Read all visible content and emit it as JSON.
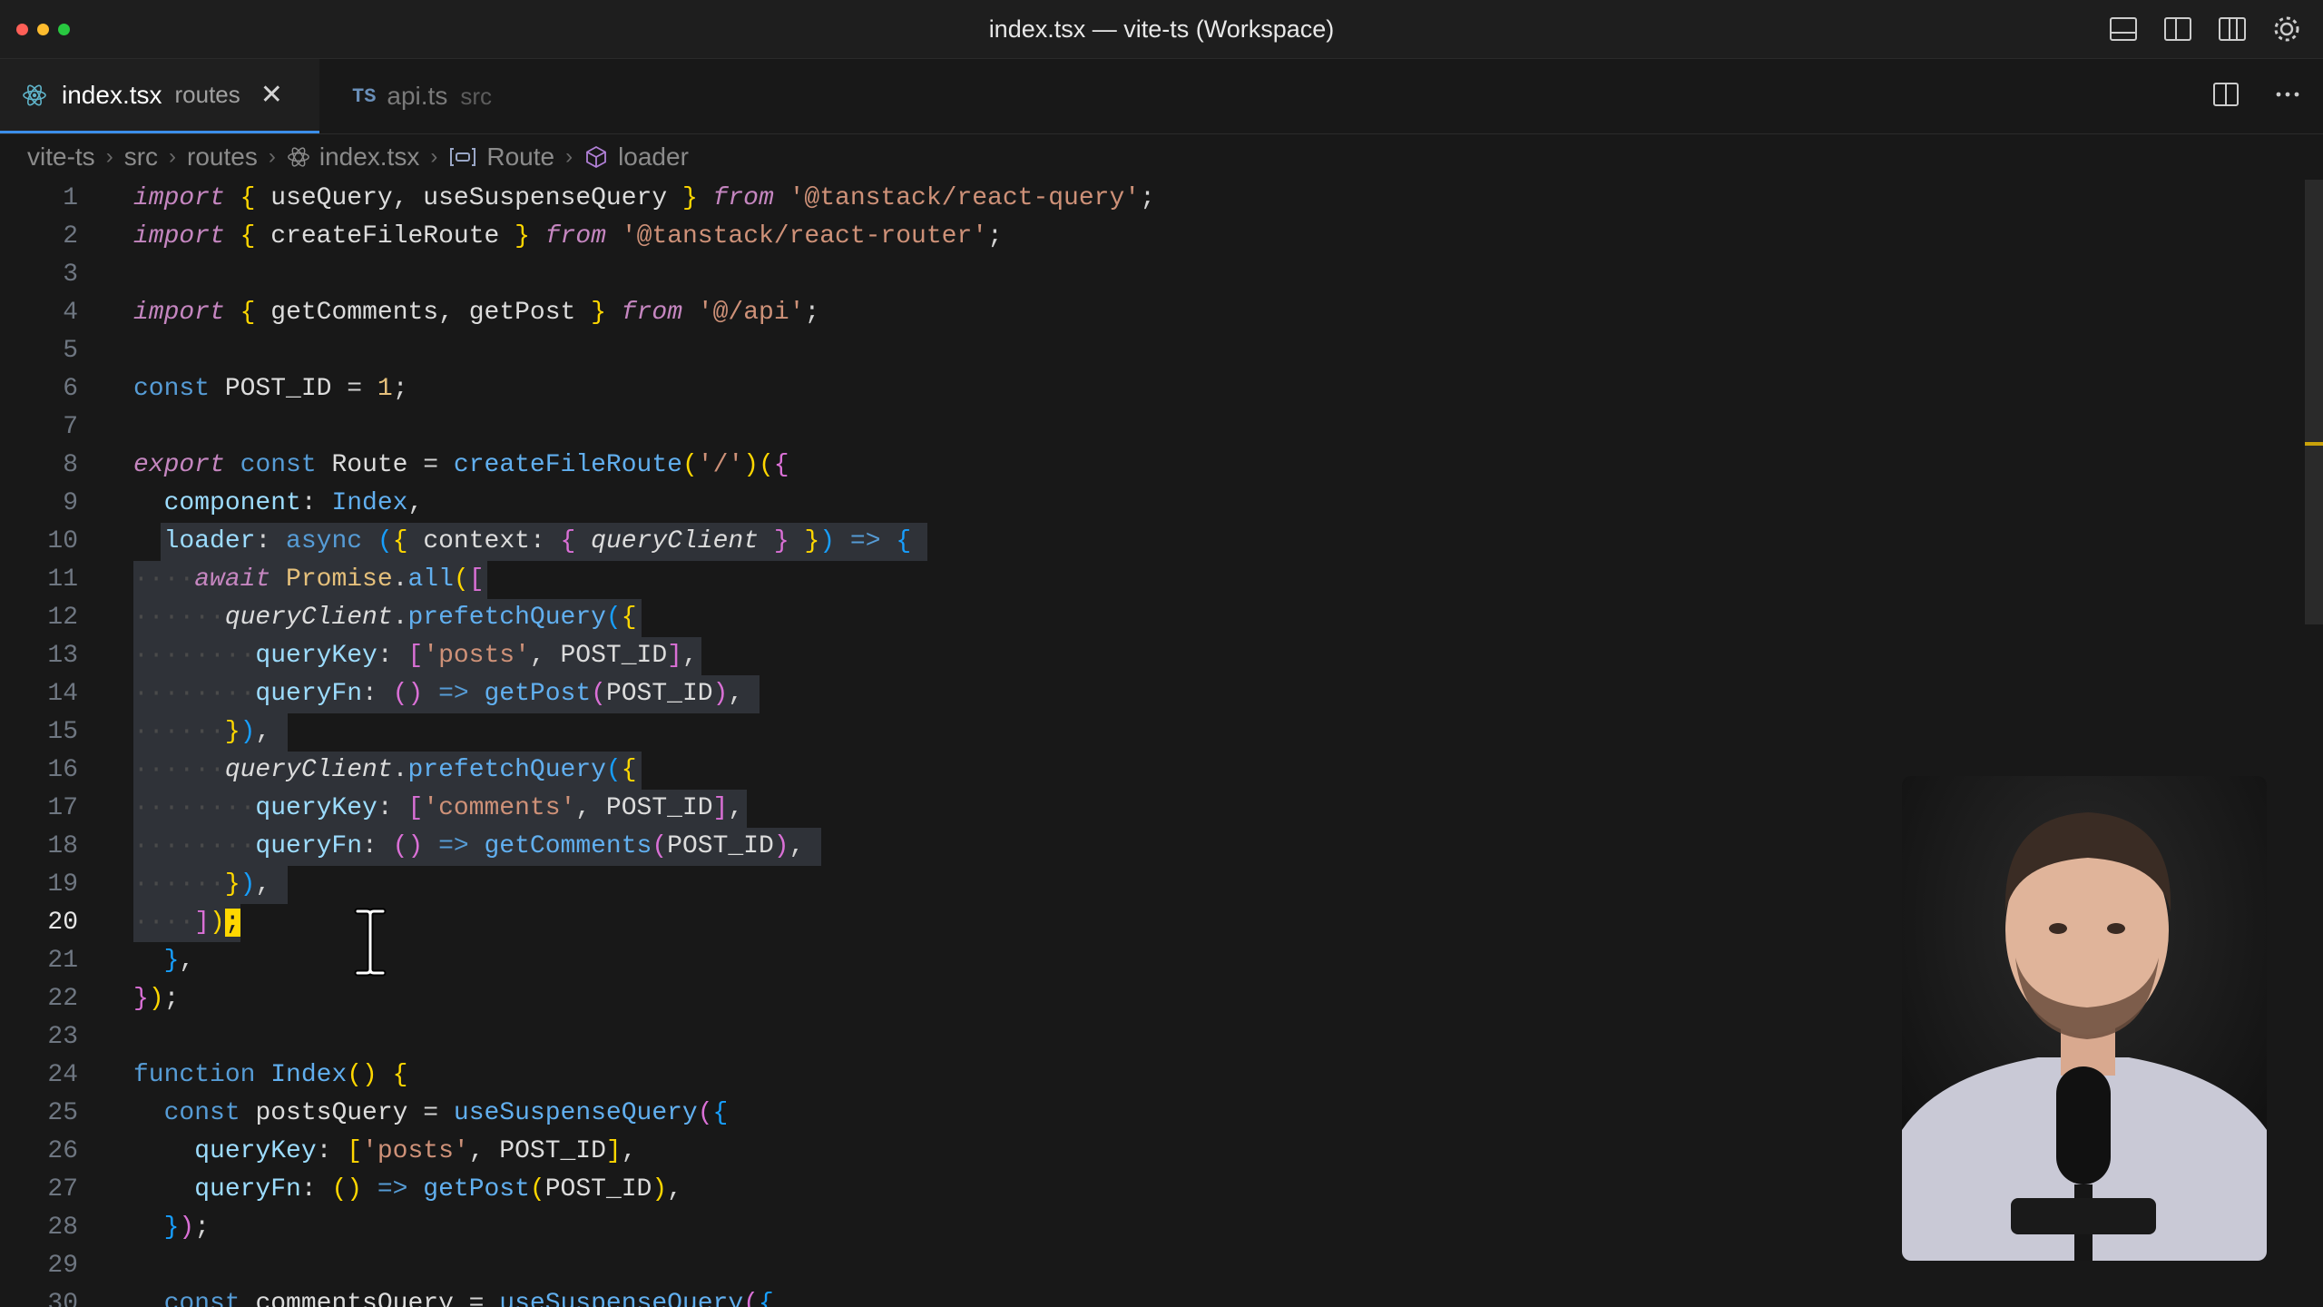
{
  "window": {
    "title": "index.tsx — vite-ts (Workspace)",
    "icons": [
      "toggle-panel-icon",
      "toggle-sidebar-icon",
      "toggle-secondary-sidebar-icon",
      "settings-gear-icon"
    ]
  },
  "tabs": [
    {
      "name": "index.tsx",
      "dir": "routes",
      "icon": "react-icon",
      "active": true
    },
    {
      "name": "api.ts",
      "dir": "src",
      "badge": "TS",
      "active": false
    }
  ],
  "tab_actions": [
    "split-editor-icon",
    "more-actions-icon"
  ],
  "breadcrumb": [
    "vite-ts",
    "src",
    "routes",
    "index.tsx",
    "Route",
    "loader"
  ],
  "editor": {
    "line_numbers": [
      "1",
      "2",
      "3",
      "4",
      "5",
      "6",
      "7",
      "8",
      "9",
      "10",
      "11",
      "12",
      "13",
      "14",
      "15",
      "16",
      "17",
      "18",
      "19",
      "20",
      "21",
      "22",
      "23",
      "24",
      "25",
      "26",
      "27",
      "28",
      "29",
      "30"
    ],
    "current_line": "20",
    "lines": [
      "import { useQuery, useSuspenseQuery } from '@tanstack/react-query';",
      "import { createFileRoute } from '@tanstack/react-router';",
      "",
      "import { getComments, getPost } from '@/api';",
      "",
      "const POST_ID = 1;",
      "",
      "export const Route = createFileRoute('/')({",
      "  component: Index,",
      "  loader: async ({ context: { queryClient } }) => {",
      "    await Promise.all([",
      "      queryClient.prefetchQuery({",
      "        queryKey: ['posts', POST_ID],",
      "        queryFn: () => getPost(POST_ID),",
      "      }),",
      "      queryClient.prefetchQuery({",
      "        queryKey: ['comments', POST_ID],",
      "        queryFn: () => getComments(POST_ID),",
      "      }),",
      "    ]);",
      "  },",
      "});",
      "",
      "function Index() {",
      "  const postsQuery = useSuspenseQuery({",
      "    queryKey: ['posts', POST_ID],",
      "    queryFn: () => getPost(POST_ID),",
      "  });",
      "",
      "  const commentsQuery = useSuspenseQuery({"
    ]
  },
  "webcam": {
    "description_icon": "presenter-video"
  }
}
